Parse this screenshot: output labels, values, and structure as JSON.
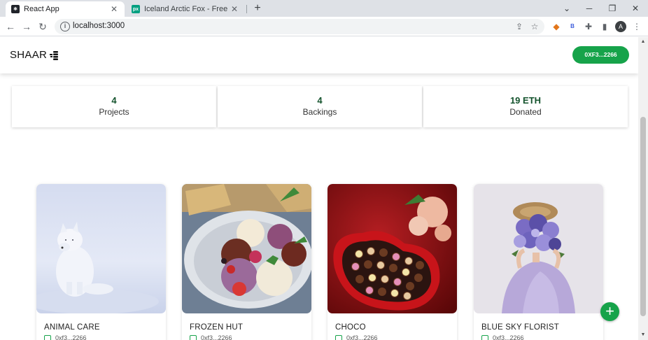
{
  "browser": {
    "tabs": [
      {
        "title": "React App",
        "favicon": "react-icon",
        "active": true
      },
      {
        "title": "Iceland Arctic Fox - Free photo o",
        "favicon": "px-icon",
        "active": false
      }
    ],
    "url": "localhost:3000",
    "profile_initial": "A"
  },
  "app": {
    "brand": "SHAAR",
    "wallet_label": "0XF3...2266",
    "accent": "#16a34a"
  },
  "stats": [
    {
      "value": "4",
      "label": "Projects"
    },
    {
      "value": "4",
      "label": "Backings"
    },
    {
      "value": "19 ETH",
      "label": "Donated"
    }
  ],
  "projects": [
    {
      "title": "ANIMAL CARE",
      "owner": "0xf3...2266"
    },
    {
      "title": "FROZEN HUT",
      "owner": "0xf3...2266"
    },
    {
      "title": "CHOCO",
      "owner": "0xf3...2266"
    },
    {
      "title": "BLUE SKY FLORIST",
      "owner": "0xf3...2266"
    }
  ]
}
